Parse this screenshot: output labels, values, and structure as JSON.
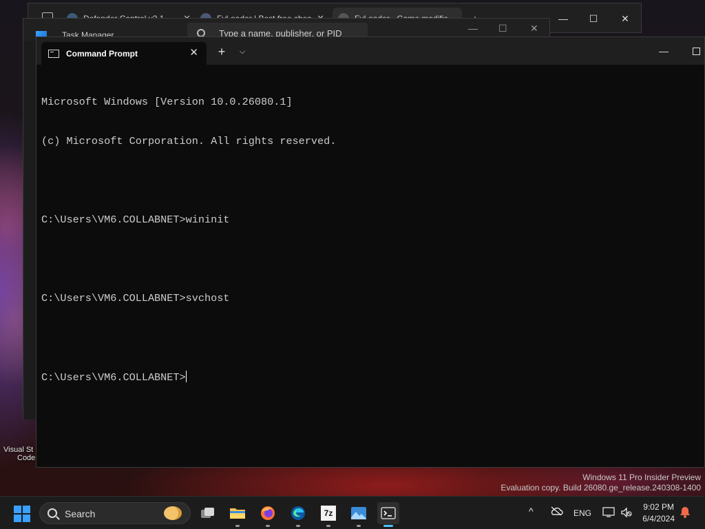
{
  "desktop": {
    "label_line1": "Visual St",
    "label_line2": "Code",
    "watermark_line1": "Windows 11 Pro Insider Preview",
    "watermark_line2": "Evaluation copy. Build 26080.ge_release.240308-1400"
  },
  "browser": {
    "tabs": [
      {
        "label": "Defender Control v2.1",
        "favicon_color": "#3c5a78"
      },
      {
        "label": "FyLoader | Best free chea",
        "favicon_color": "#4a5a7a"
      },
      {
        "label": "FyLoader - Game modific",
        "favicon_color": "#555555"
      }
    ]
  },
  "task_manager": {
    "title": "Task Manager",
    "search_placeholder": "Type a name, publisher, or PID"
  },
  "terminal": {
    "tab_title": "Command Prompt",
    "new_tab_icon": "plus-icon",
    "lines": [
      "Microsoft Windows [Version 10.0.26080.1]",
      "(c) Microsoft Corporation. All rights reserved.",
      "",
      "C:\\Users\\VM6.COLLABNET>wininit",
      "",
      "C:\\Users\\VM6.COLLABNET>svchost",
      ""
    ],
    "prompt": "C:\\Users\\VM6.COLLABNET>"
  },
  "taskbar": {
    "search_label": "Search",
    "apps": [
      {
        "name": "task-view-icon"
      },
      {
        "name": "file-explorer-icon"
      },
      {
        "name": "firefox-icon"
      },
      {
        "name": "edge-icon"
      },
      {
        "name": "7zip-icon",
        "label": "7z"
      },
      {
        "name": "photos-icon"
      },
      {
        "name": "terminal-icon"
      }
    ],
    "tray": {
      "language": "ENG",
      "time": "9:02 PM",
      "date": "6/4/2024"
    }
  }
}
